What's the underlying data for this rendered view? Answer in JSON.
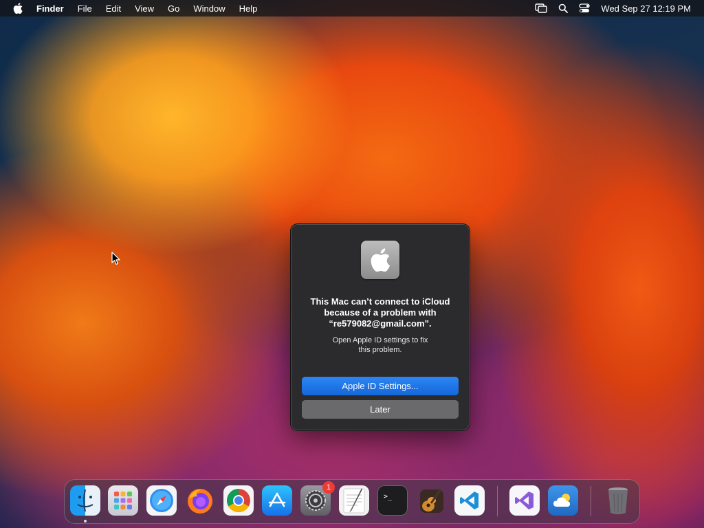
{
  "menubar": {
    "app_name": "Finder",
    "items": [
      "File",
      "Edit",
      "View",
      "Go",
      "Window",
      "Help"
    ],
    "clock": "Wed Sep 27  12:19 PM",
    "status_icons": [
      "screen-mirroring-icon",
      "spotlight-search-icon",
      "control-center-icon"
    ]
  },
  "dialog": {
    "icon": "apple-logo-icon",
    "title_lines": [
      "This Mac can’t connect to iCloud",
      "because of a problem with",
      "“re579082@gmail.com”."
    ],
    "message_lines": [
      "Open Apple ID settings to fix",
      "this problem."
    ],
    "primary_button": "Apple ID Settings...",
    "secondary_button": "Later",
    "accent_color": "#1f74e6"
  },
  "dock": {
    "apps": [
      {
        "name": "Finder",
        "icon": "finder-icon",
        "running": true
      },
      {
        "name": "Launchpad",
        "icon": "launchpad-icon"
      },
      {
        "name": "Safari",
        "icon": "safari-icon"
      },
      {
        "name": "Firefox",
        "icon": "firefox-icon"
      },
      {
        "name": "Google Chrome",
        "icon": "chrome-icon"
      },
      {
        "name": "App Store",
        "icon": "app-store-icon"
      },
      {
        "name": "System Settings",
        "icon": "system-settings-icon",
        "badge": "1"
      },
      {
        "name": "TextEdit",
        "icon": "textedit-icon"
      },
      {
        "name": "Terminal",
        "icon": "terminal-icon"
      },
      {
        "name": "Instruments",
        "icon": "guitar-icon"
      },
      {
        "name": "Visual Studio Code",
        "icon": "vscode-icon"
      },
      {
        "name": "Visual Studio",
        "icon": "visual-studio-icon"
      },
      {
        "name": "Weather",
        "icon": "weather-icon"
      },
      {
        "name": "Trash",
        "icon": "trash-icon"
      }
    ]
  }
}
